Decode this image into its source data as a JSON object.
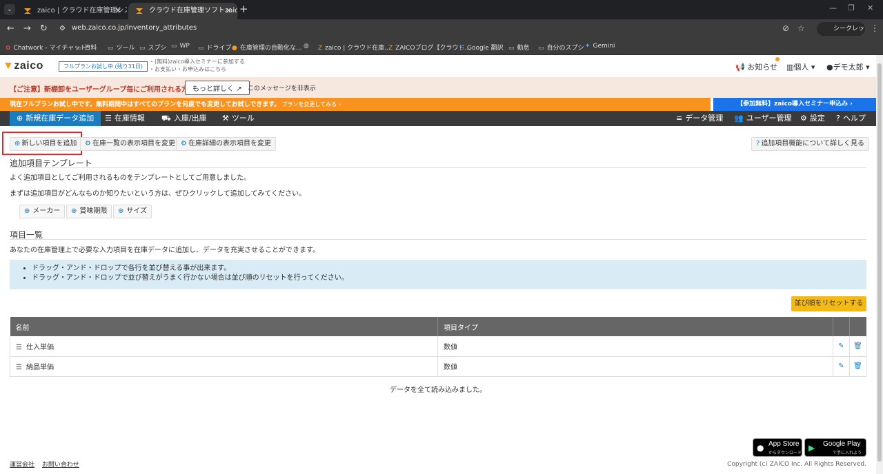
{
  "browser": {
    "tabs": [
      {
        "title": "zaico | クラウド在庫管理システム(",
        "active": false
      },
      {
        "title": "クラウド在庫管理ソフトzaico | 無料",
        "active": true
      }
    ],
    "url": "web.zaico.co.jp/inventory_attributes",
    "incognito_label": "シークレット",
    "bookmarks": [
      "Chatwork - マイチャット",
      "資料",
      "ツール",
      "スプシ",
      "WP",
      "ドライブ",
      "在庫管理の自動化な...",
      "",
      "zaico | クラウド在庫...",
      "ZAICOブログ【クラウド...",
      "Google 翻訳",
      "勤怠",
      "自分のスプシ",
      "Gemini"
    ]
  },
  "header": {
    "logo": "zaico",
    "trial_badge": "フルプランお試し中 (残り31日)",
    "seminar_line1": "・(無料)zaico導入セミナーに参加する",
    "seminar_line2": "・お支払い・お申込みはこちら",
    "notifications": "お知らせ",
    "workspace": "個人",
    "user": "デモ太郎"
  },
  "notice": {
    "warning": "【ご注意】新棚卸をユーザーグループ毎にご利用される方へ",
    "more_button": "もっと詳しく",
    "hide_link": "このメッセージを非表示"
  },
  "trial_bar": {
    "text": "現在フルプランお試し中です。無料期間中はすべてのプランを何度でも変更してお試しできます。",
    "plan_link": "プランを変更してみる ›",
    "seminar_button": "【参加無料】zaico導入セミナー申込み ›"
  },
  "nav": {
    "left": [
      "新規在庫データ追加",
      "在庫情報",
      "入庫/出庫",
      "ツール"
    ],
    "right": [
      "データ管理",
      "ユーザー管理",
      "設定",
      "ヘルプ"
    ]
  },
  "actions": {
    "add_new": "新しい項目を追加",
    "list_display": "在庫一覧の表示項目を変更",
    "detail_display": "在庫詳細の表示項目を変更",
    "learn_more": "追加項目機能について詳しく見る"
  },
  "templates": {
    "title": "追加項目テンプレート",
    "desc1": "よく追加項目としてご利用されるものをテンプレートとしてご用意しました。",
    "desc2": "まずは追加項目がどんなものか知りたいという方は、ぜひクリックして追加してみてください。",
    "items": [
      "メーカー",
      "賞味期限",
      "サイズ"
    ]
  },
  "items_section": {
    "title": "項目一覧",
    "desc": "あなたの在庫管理上で必要な入力項目を在庫データに追加し、データを充実させることができます。",
    "tips": [
      "ドラッグ・アンド・ドロップで各行を並び替える事が出来ます。",
      "ドラッグ・アンド・ドロップで並び替えがうまく行かない場合は並び順のリセットを行ってください。"
    ],
    "reset_button": "並び順をリセットする",
    "columns": [
      "名前",
      "項目タイプ"
    ],
    "rows": [
      {
        "name": "仕入単価",
        "type": "数値"
      },
      {
        "name": "納品単価",
        "type": "数値"
      }
    ],
    "loaded_msg": "データを全て読み込みました。"
  },
  "footer": {
    "links": [
      "運営会社",
      "お問い合わせ"
    ],
    "app_store": {
      "big": "App Store",
      "small": "からダウンロード"
    },
    "google_play": {
      "big": "Google Play",
      "small": "で手に入れよう"
    },
    "copyright": "Copyright (c) ZAICO Inc. All Rights Reserved."
  },
  "colors": {
    "brand_blue": "#1a7bbf",
    "orange": "#f7931e",
    "yellow": "#f5b914",
    "highlight_red": "#d32f2f"
  }
}
